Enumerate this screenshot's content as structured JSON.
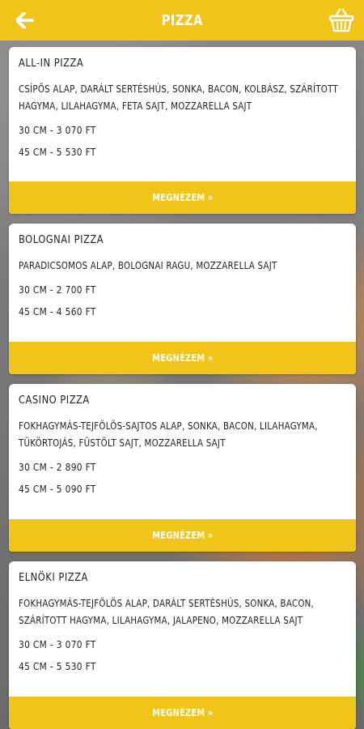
{
  "header": {
    "title": "PIZZA",
    "back_icon": "arrow-left-icon",
    "cart_icon": "basket-icon"
  },
  "colors": {
    "accent": "#f0c419",
    "card": "#ffffff",
    "text": "#222222"
  },
  "pizzas": [
    {
      "name": "ALL-IN PIZZA",
      "ingredients": "CSÍPŐS ALAP, DARÁLT SERTÉSHÚS, SONKA, BACON, KOLBÁSZ, SZÁRÍTOTT HAGYMA, LILAHAGYMA, FETA SAJT, MOZZARELLA SAJT",
      "price_30": "30 CM - 3 070 FT",
      "price_45": "45 CM - 5 530 FT",
      "button": "MEGNÉZEM »"
    },
    {
      "name": "BOLOGNAI PIZZA",
      "ingredients": "PARADICSOMOS ALAP, BOLOGNAI RAGU, MOZZARELLA SAJT",
      "price_30": "30 CM - 2 700 FT",
      "price_45": "45 CM - 4 560 FT",
      "button": "MEGNÉZEM »"
    },
    {
      "name": "CASINO PIZZA",
      "ingredients": "FOKHAGYMÁS-TEJFÖLÖS-SAJTOS ALAP, SONKA, BACON, LILAHAGYMA, TÜKÖRTOJÁS, FÜSTÖLT SAJT, MOZZARELLA SAJT",
      "price_30": "30 CM - 2 890 FT",
      "price_45": "45 CM - 5 090 FT",
      "button": "MEGNÉZEM »"
    },
    {
      "name": "ELNÖKI PIZZA",
      "ingredients": "FOKHAGYMÁS-TEJFÖLÖS ALAP, DARÁLT SERTÉSHÚS, SONKA, BACON, SZÁRÍTOTT HAGYMA, LILAHAGYMA, JALAPENO, MOZZARELLA SAJT",
      "price_30": "30 CM - 3 070 FT",
      "price_45": "45 CM - 5 530 FT",
      "button": "MEGNÉZEM »"
    }
  ]
}
